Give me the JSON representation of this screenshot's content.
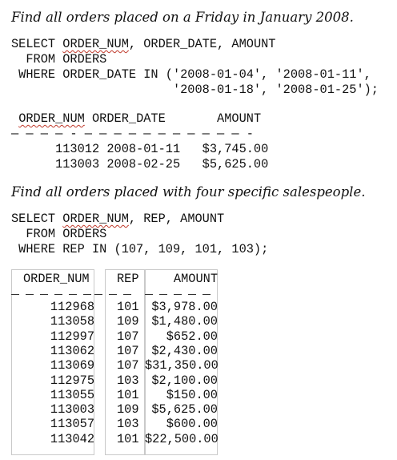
{
  "example1": {
    "caption": "Find all orders placed on a Friday in January 2008.",
    "sql": {
      "line1_prefix": "SELECT ",
      "line1_col": "ORDER_NUM",
      "line1_rest": ", ORDER_DATE, AMOUNT",
      "line2": "  FROM ORDERS",
      "line3": " WHERE ORDER_DATE IN ('2008-01-04', '2008-01-11',",
      "line4": "                      '2008-01-18', '2008-01-25');"
    },
    "result": {
      "header_pre": " ",
      "header_col1": "ORDER_NUM",
      "header_rest": " ORDER_DATE       AMOUNT",
      "separator": "— — — — - — — — — — — — — — — — -",
      "rows": [
        "      113012 2008-01-11   $3,745.00",
        "      113003 2008-02-25   $5,625.00"
      ]
    }
  },
  "example2": {
    "caption": "Find all orders placed with four specific salespeople.",
    "sql": {
      "line1_prefix": "SELECT ",
      "line1_col": "ORDER_NUM",
      "line1_rest": ", REP, AMOUNT",
      "line2": "  FROM ORDERS",
      "line3": " WHERE REP IN (107, 109, 101, 103);"
    },
    "result": {
      "headers": {
        "order_num": "ORDER_NUM",
        "rep": "REP",
        "amount": "AMOUNT"
      },
      "rows": [
        {
          "order_num": "112968",
          "rep": "101",
          "amount": "$3,978.00"
        },
        {
          "order_num": "113058",
          "rep": "109",
          "amount": "$1,480.00"
        },
        {
          "order_num": "112997",
          "rep": "107",
          "amount": "$652.00"
        },
        {
          "order_num": "113062",
          "rep": "107",
          "amount": "$2,430.00"
        },
        {
          "order_num": "113069",
          "rep": "107",
          "amount": "$31,350.00"
        },
        {
          "order_num": "112975",
          "rep": "103",
          "amount": "$2,100.00"
        },
        {
          "order_num": "113055",
          "rep": "101",
          "amount": "$150.00"
        },
        {
          "order_num": "113003",
          "rep": "109",
          "amount": "$5,625.00"
        },
        {
          "order_num": "113057",
          "rep": "103",
          "amount": "$600.00"
        },
        {
          "order_num": "113042",
          "rep": "101",
          "amount": "$22,500.00"
        }
      ]
    }
  },
  "colors": {
    "squiggle": "#c0392b",
    "grid_border": "#c9c9c9",
    "text": "#111111"
  }
}
